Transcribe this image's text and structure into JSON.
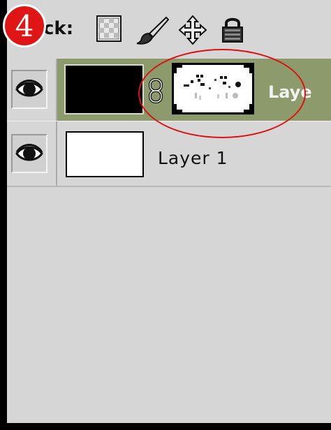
{
  "step": {
    "number": "4",
    "color": "#e01515"
  },
  "lock_toolbar": {
    "label": "ck:",
    "icons": [
      "lock-transparent-pixels-icon",
      "lock-image-pixels-icon",
      "lock-position-icon",
      "lock-all-icon"
    ]
  },
  "layers": [
    {
      "name": "Laye",
      "selected": true,
      "visible": true,
      "thumbnail": "black-fill",
      "has_mask": true,
      "linked": true
    },
    {
      "name": "Layer 1",
      "selected": false,
      "visible": true,
      "thumbnail": "white-fill",
      "has_mask": false
    }
  ],
  "colors": {
    "panel_bg": "#d6d6d6",
    "selected_row": "#8c9a6c",
    "highlight": "#d11111"
  }
}
